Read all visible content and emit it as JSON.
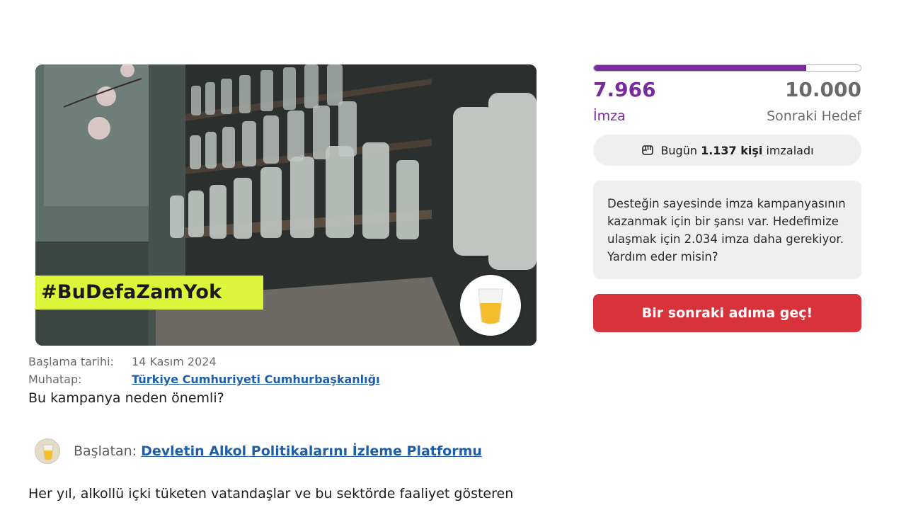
{
  "campaign": {
    "hashtag": "#BuDefaZamYok",
    "start_label": "Başlama tarihi:",
    "start_value": "14 Kasım 2024",
    "target_label": "Muhatap:",
    "target_value": "Türkiye Cumhuriyeti Cumhurbaşkanlığı",
    "why_heading": "Bu kampanya neden önemli?",
    "starter_label": "Başlatan:",
    "starter_name": "Devletin Alkol Politikalarını İzleme Platformu",
    "body_first_line": "Her yıl, alkollü içki tüketen vatandaşlar ve bu sektörde faaliyet gösteren"
  },
  "signatures": {
    "current": "7.966",
    "current_label": "İmza",
    "goal": "10.000",
    "goal_label": "Sonraki Hedef",
    "progress_fraction": 0.7966,
    "today_prefix": "Bugün ",
    "today_count": "1.137 kişi",
    "today_suffix": " imzaladı",
    "support_message": "Desteğin sayesinde imza kampanyasının kazanmak için bir şansı var. Hedefimize ulaşmak için 2.034 imza daha gerekiyor. Yardım eder misin?",
    "cta_label": "Bir sonraki adıma geç!"
  },
  "colors": {
    "brand_purple": "#792c9b",
    "cta_red": "#d8323a",
    "hashtag_bg": "#dcf53a",
    "link_blue": "#1f5fa8"
  },
  "icons": {
    "today": "fist-icon",
    "starter": "beer-glass-icon"
  }
}
